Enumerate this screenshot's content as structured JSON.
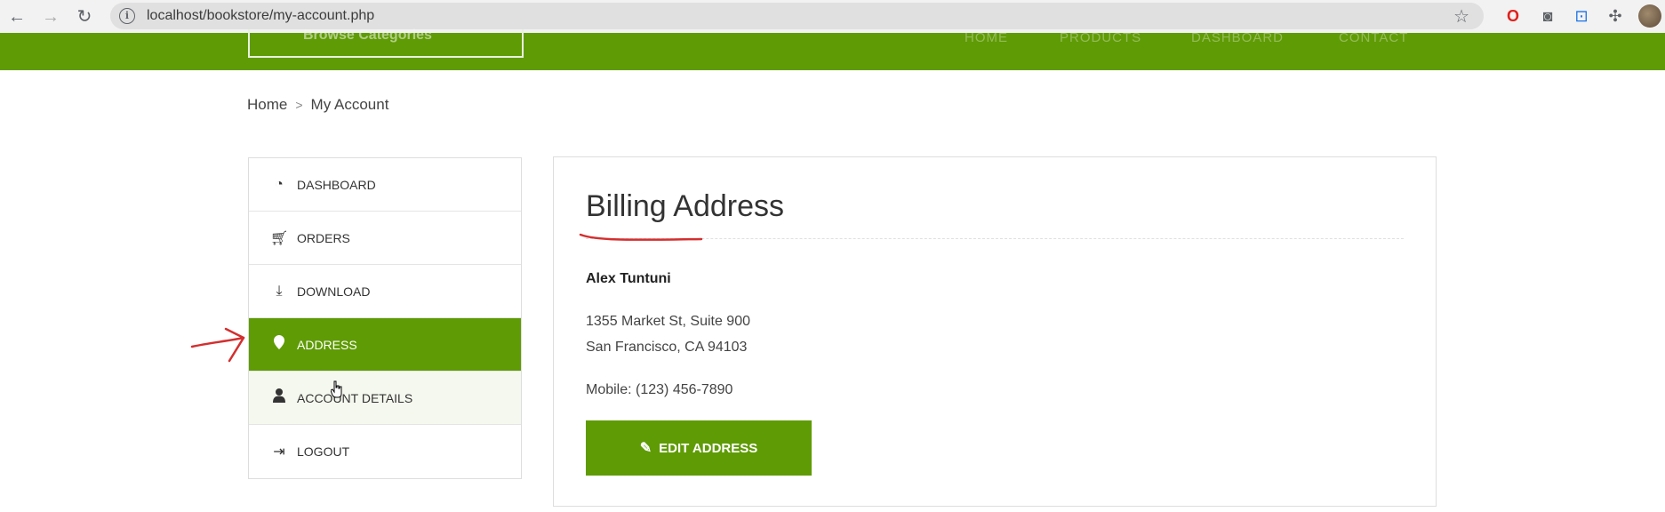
{
  "browser": {
    "url": "localhost/bookstore/my-account.php",
    "icons": [
      "back-icon",
      "forward-icon",
      "reload-icon",
      "info-icon",
      "star-icon",
      "opera-icon",
      "camera-icon",
      "screenshot-icon",
      "puzzle-icon",
      "profile-avatar"
    ]
  },
  "header": {
    "browse_label": "Browse Categories",
    "menu": [
      "HOME",
      "PRODUCTS",
      "DASHBOARD",
      "CONTACT"
    ]
  },
  "breadcrumb": {
    "home": "Home",
    "separator": ">",
    "current": "My Account"
  },
  "sidebar": {
    "items": [
      {
        "label": "DASHBOARD",
        "icon": "dashboard-icon",
        "glyph": "◔"
      },
      {
        "label": "ORDERS",
        "icon": "cart-icon",
        "glyph": "🛒"
      },
      {
        "label": "DOWNLOAD",
        "icon": "download-icon",
        "glyph": "⤓"
      },
      {
        "label": "ADDRESS",
        "icon": "map-marker-icon",
        "glyph": "●",
        "active": true
      },
      {
        "label": "ACCOUNT DETAILS",
        "icon": "user-icon",
        "glyph": "👤"
      },
      {
        "label": "LOGOUT",
        "icon": "logout-icon",
        "glyph": "⇥"
      }
    ]
  },
  "panel": {
    "title": "Billing Address",
    "name": "Alex Tuntuni",
    "address_line1": "1355 Market St, Suite 900",
    "address_line2": "San Francisco, CA 94103",
    "mobile": "Mobile: (123) 456-7890",
    "edit_button": "EDIT ADDRESS"
  },
  "colors": {
    "brand_green": "#5f9b05",
    "annotation_red": "#d32f2f"
  }
}
